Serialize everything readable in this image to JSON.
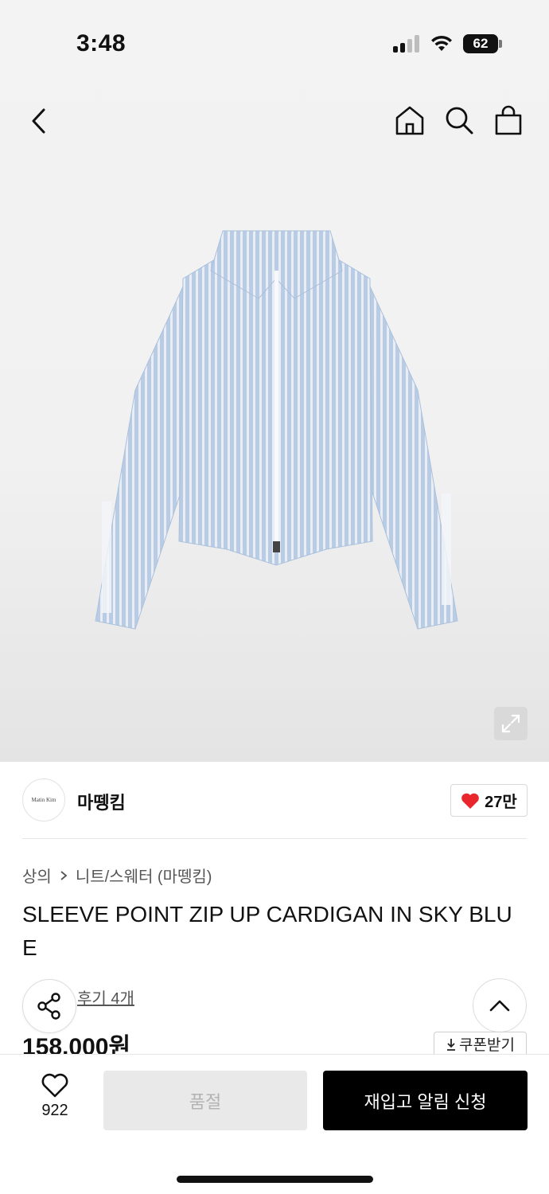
{
  "status_bar": {
    "time": "3:48",
    "battery": "62"
  },
  "header": {
    "back_icon": "chevron-left-icon",
    "home_icon": "home-icon",
    "search_icon": "search-icon",
    "bag_icon": "shopping-bag-icon"
  },
  "product": {
    "image": "sky-blue-zip-up-cardigan",
    "expand_icon": "expand-icon",
    "brand": {
      "logo_text": "Matin Kim",
      "name": "마뗑킴"
    },
    "brand_likes": "27만",
    "breadcrumb": {
      "category": "상의",
      "subcategory": "니트/스웨터 (마뗑킴)"
    },
    "title": "SLEEVE POINT ZIP UP CARDIGAN IN SKY BLUE",
    "review_link": "후기 4개",
    "price": "158,000원",
    "coupon_label": "쿠폰받기"
  },
  "bottom_bar": {
    "wish_count": "922",
    "soldout_label": "품절",
    "restock_label": "재입고 알림 신청"
  },
  "colors": {
    "accent_heart": "#e8262b",
    "primary_button": "#000000",
    "disabled_button": "#e9e9e9"
  }
}
